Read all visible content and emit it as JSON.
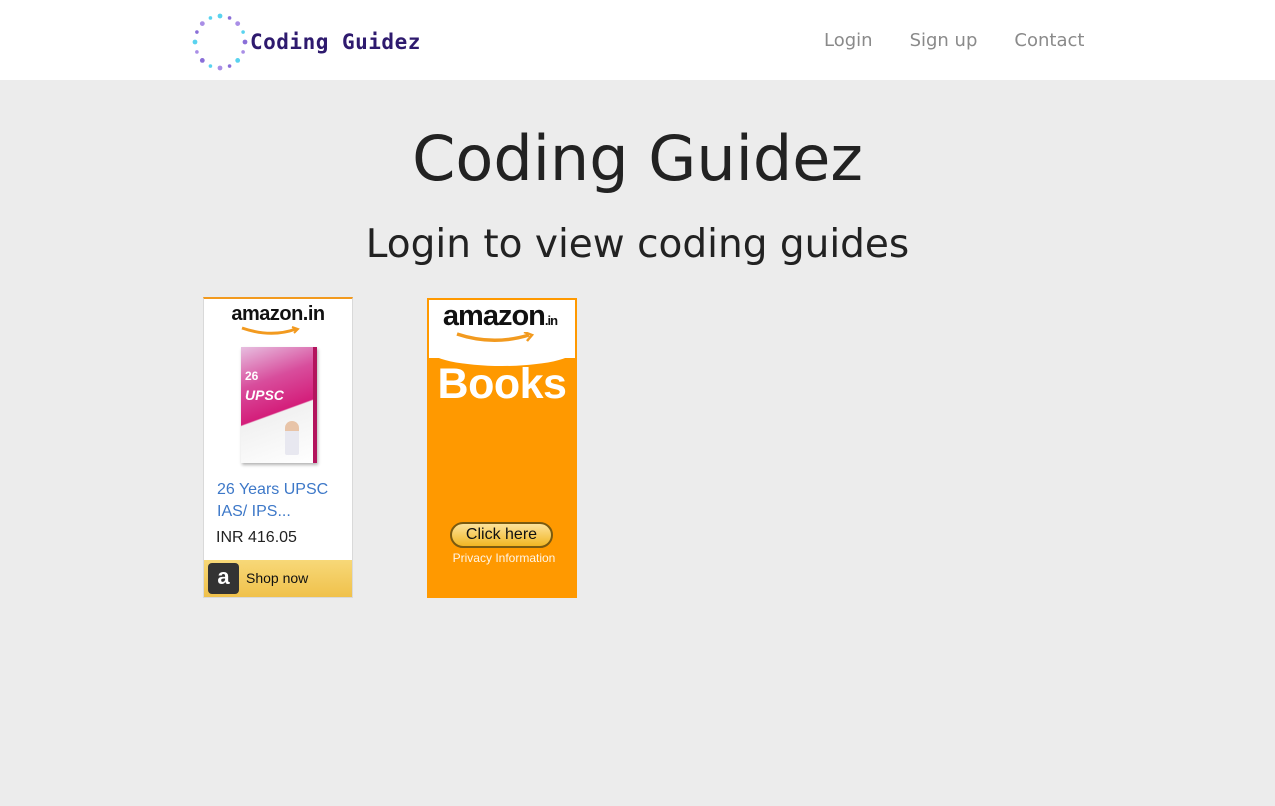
{
  "navbar": {
    "brand_name": "Coding Guidez",
    "links": [
      "Login",
      "Sign up",
      "Contact"
    ]
  },
  "hero": {
    "title": "Coding Guidez",
    "subtitle": "Login to view coding guides"
  },
  "ads": [
    {
      "logo": "amazon.in",
      "book_badge": "26",
      "book_title": "UPSC",
      "product_title": "26 Years UPSC IAS/ IPS...",
      "price": "INR 416.05",
      "cta": "Shop now",
      "cta_icon": "a"
    },
    {
      "logo": "amazon",
      "logo_suffix": ".in",
      "headline": "Books",
      "button": "Click here",
      "privacy": "Privacy Information"
    }
  ],
  "colors": {
    "brand_text": "#2e1a6e",
    "amazon_orange": "#ff9900",
    "link_blue": "#3d78c8",
    "page_bg": "#ececec"
  }
}
